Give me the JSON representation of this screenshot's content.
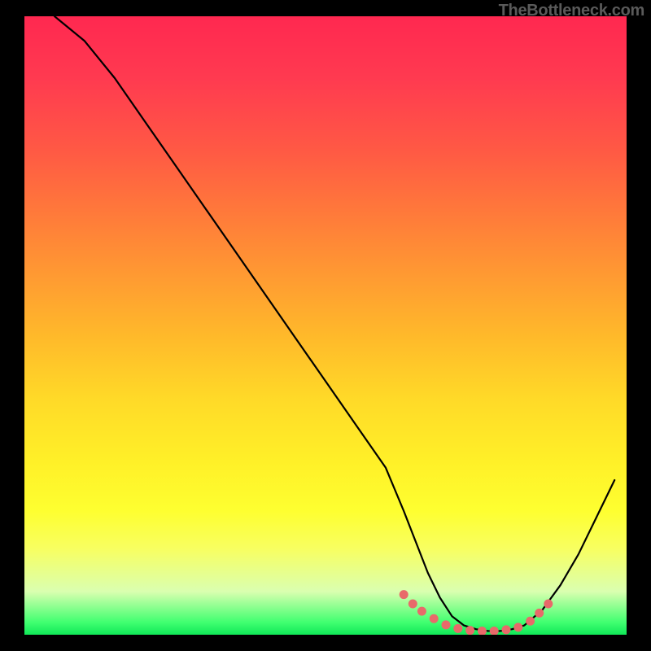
{
  "attribution": "TheBottleneck.com",
  "chart_data": {
    "type": "line",
    "title": "",
    "xlabel": "",
    "ylabel": "",
    "xlim": [
      0,
      100
    ],
    "ylim": [
      0,
      100
    ],
    "series": [
      {
        "name": "bottleneck-curve",
        "x": [
          5,
          10,
          15,
          20,
          25,
          30,
          35,
          40,
          45,
          50,
          55,
          60,
          63,
          65,
          67,
          69,
          71,
          73,
          75,
          77,
          79,
          81,
          83,
          86,
          89,
          92,
          95,
          98
        ],
        "values": [
          100,
          96,
          90,
          83,
          76,
          69,
          62,
          55,
          48,
          41,
          34,
          27,
          20,
          15,
          10,
          6,
          3,
          1.5,
          0.9,
          0.6,
          0.6,
          0.9,
          1.5,
          4,
          8,
          13,
          19,
          25
        ]
      }
    ],
    "markers": {
      "name": "highlight-dots",
      "color": "#e86a6a",
      "x": [
        63,
        64.5,
        66,
        68,
        70,
        72,
        74,
        76,
        78,
        80,
        82,
        84,
        85.5,
        87
      ],
      "values": [
        6.5,
        5,
        3.8,
        2.6,
        1.6,
        1.0,
        0.7,
        0.6,
        0.6,
        0.8,
        1.2,
        2.2,
        3.5,
        5.0
      ]
    },
    "gradient_colors": {
      "top": "#ff2850",
      "bottom": "#10e858"
    }
  }
}
